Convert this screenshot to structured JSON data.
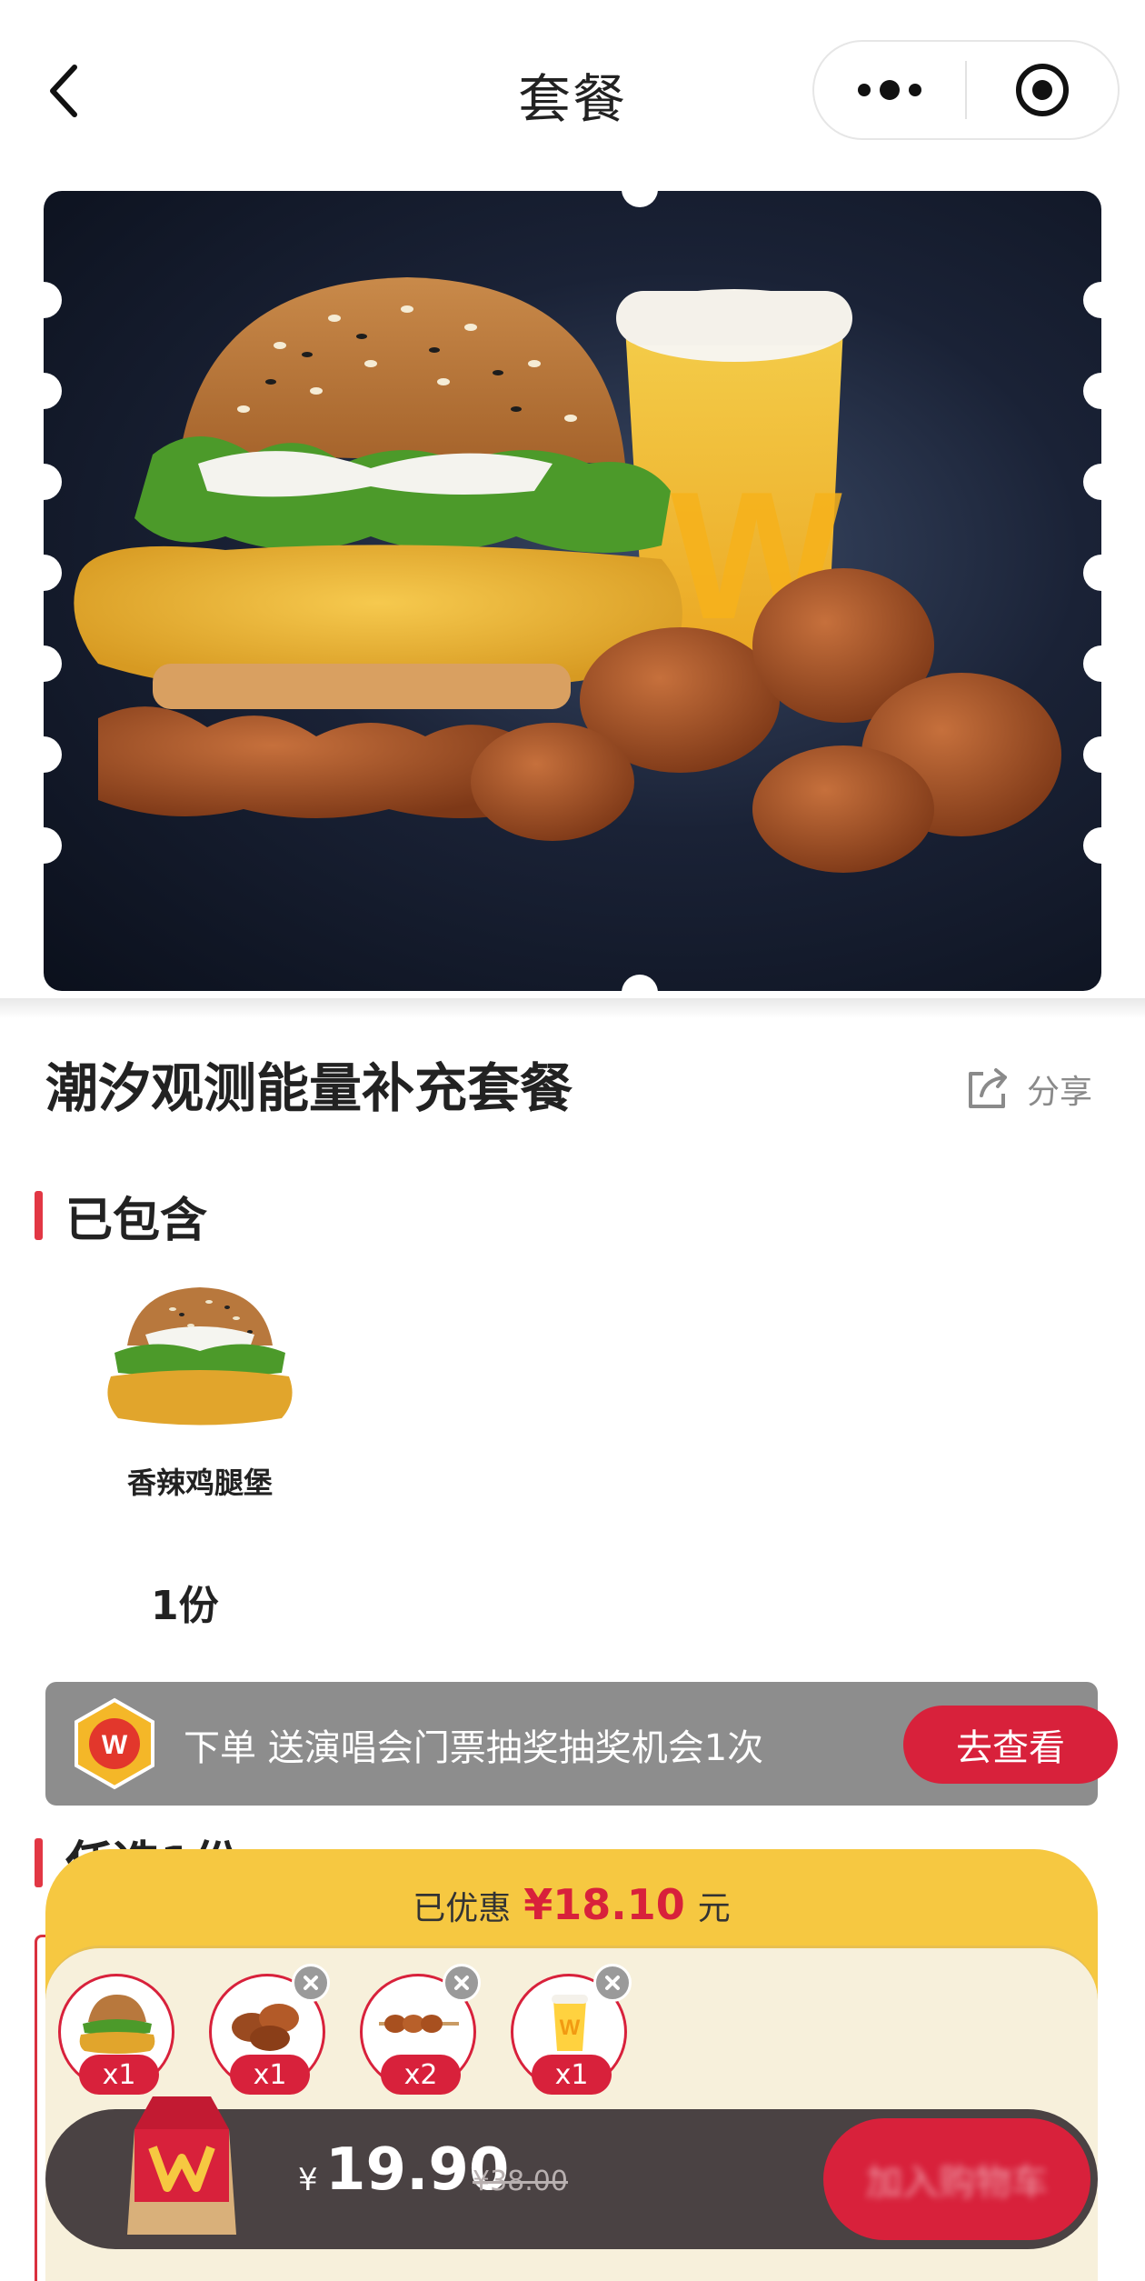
{
  "header": {
    "title": "套餐",
    "back_icon": "chevron-left-icon",
    "more_icon": "more-dots-icon",
    "close_icon": "target-circle-icon"
  },
  "hero": {
    "image": "burger-drink-wings-combo-photo"
  },
  "product": {
    "title": "潮汐观测能量补充套餐",
    "share_label": "分享"
  },
  "included": {
    "section_title": "已包含",
    "items": [
      {
        "name": "香辣鸡腿堡",
        "quantity": "1份"
      }
    ]
  },
  "promo": {
    "text": "下单 送演唱会门票抽奖抽奖机会1次",
    "button_label": "去查看"
  },
  "optional": {
    "section_title": "任选1份"
  },
  "cart": {
    "discount_label": "已优惠",
    "discount_amount": "¥18.10",
    "discount_unit": "元",
    "items": [
      {
        "name": "burger",
        "qty": "x1",
        "removable": false
      },
      {
        "name": "wings",
        "qty": "x1",
        "removable": true
      },
      {
        "name": "skewer",
        "qty": "x2",
        "removable": true
      },
      {
        "name": "drink",
        "qty": "x1",
        "removable": true
      }
    ],
    "currency": "¥",
    "price": "19.90",
    "original_price": "¥38.00",
    "checkout_label": "加入购物车"
  },
  "colors": {
    "accent": "#d8213b",
    "panel_yellow": "#f6c841",
    "checkout_bar": "#4a4243"
  }
}
